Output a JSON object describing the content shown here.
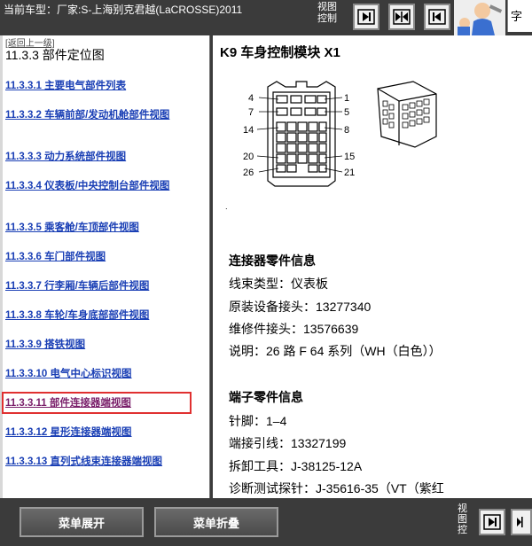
{
  "topbar": {
    "vehicle": "当前车型：厂家:S-上海别克君越(LaCROSSE)2011",
    "view_control": "视图控制",
    "right_char": "字"
  },
  "left": {
    "back": "[返回上一级]",
    "title": "11.3.3 部件定位图",
    "items": [
      {
        "label": "11.3.3.1 主要电气部件列表"
      },
      {
        "label": "11.3.3.2 车辆前部/发动机舱部件视图"
      },
      {
        "label": "11.3.3.3 动力系统部件视图"
      },
      {
        "label": "11.3.3.4 仪表板/中央控制台部件视图"
      },
      {
        "label": "11.3.3.5 乘客舱/车顶部件视图"
      },
      {
        "label": "11.3.3.6 车门部件视图"
      },
      {
        "label": "11.3.3.7 行李厢/车辆后部件视图"
      },
      {
        "label": "11.3.3.8 车轮/车身底部部件视图"
      },
      {
        "label": "11.3.3.9 搭铁视图"
      },
      {
        "label": "11.3.3.10 电气中心标识视图"
      },
      {
        "label": "11.3.3.11 部件连接器端视图"
      },
      {
        "label": "11.3.3.12 星形连接器端视图"
      },
      {
        "label": "11.3.3.13 直列式线束连接器端视图"
      }
    ]
  },
  "doc": {
    "title": "K9 车身控制模块  X1",
    "pin_labels": {
      "p4": "4",
      "p1": "1",
      "p7": "7",
      "p5": "5",
      "p14": "14",
      "p8": "8",
      "p20": "20",
      "p15": "15",
      "p26": "26",
      "p21": "21"
    },
    "connector_heading": "连接器零件信息",
    "connector_lines": [
      "线束类型：仪表板",
      "原装设备接头：13277340",
      "维修件接头：13576639",
      "说明：26 路  F 64 系列（WH（白色））"
    ],
    "terminal_heading": "端子零件信息",
    "terminal_lines": [
      "针脚：1–4",
      "端接引线：13327199",
      "拆卸工具：J-38125-12A",
      "诊断测试探针：J-35616-35（VT（紫红"
    ]
  },
  "bottombar": {
    "expand": "菜单展开",
    "collapse": "菜单折叠",
    "view_control": "视图控"
  }
}
